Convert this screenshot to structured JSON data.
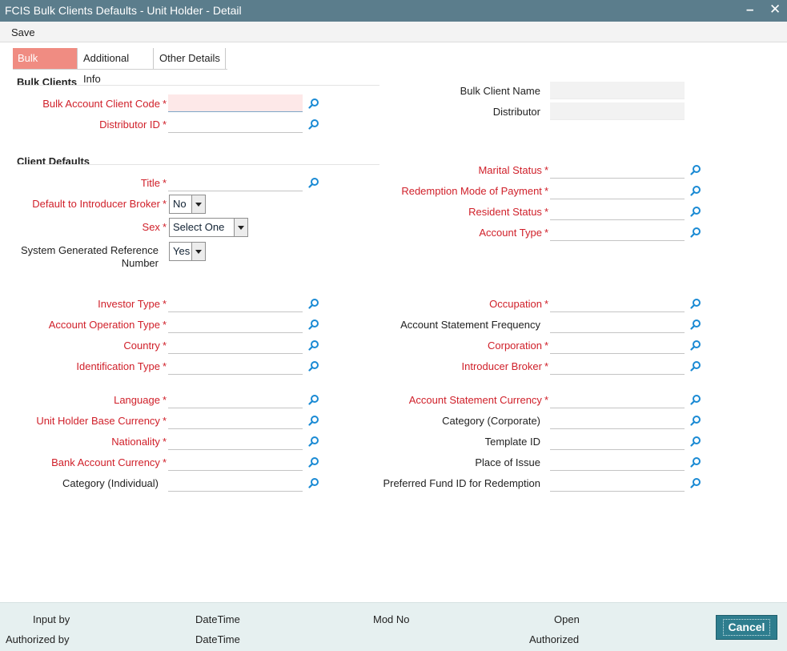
{
  "window": {
    "title": "FCIS Bulk Clients Defaults - Unit Holder - Detail"
  },
  "menu": {
    "save": "Save"
  },
  "tabs": [
    {
      "label": "Bulk Clients",
      "active": true
    },
    {
      "label": "Additional Info",
      "active": false
    },
    {
      "label": "Other Details",
      "active": false
    }
  ],
  "sections": {
    "bulk_clients": "Bulk Clients",
    "client_defaults": "Client Defaults"
  },
  "fields": {
    "bulk_account_client_code": {
      "label": "Bulk Account Client Code",
      "value": ""
    },
    "distributor_id": {
      "label": "Distributor ID",
      "value": ""
    },
    "bulk_client_name": {
      "label": "Bulk Client Name",
      "value": ""
    },
    "distributor": {
      "label": "Distributor",
      "value": ""
    },
    "title": {
      "label": "Title",
      "value": ""
    },
    "default_to_introducer_broker": {
      "label": "Default to Introducer Broker",
      "value": "No"
    },
    "sex": {
      "label": "Sex",
      "value": "Select One"
    },
    "system_generated_reference_number": {
      "label": "System Generated Reference Number",
      "value": "Yes"
    },
    "marital_status": {
      "label": "Marital Status",
      "value": ""
    },
    "redemption_mode_of_payment": {
      "label": "Redemption Mode of Payment",
      "value": ""
    },
    "resident_status": {
      "label": "Resident Status",
      "value": ""
    },
    "account_type": {
      "label": "Account Type",
      "value": ""
    },
    "investor_type": {
      "label": "Investor Type",
      "value": ""
    },
    "account_operation_type": {
      "label": "Account Operation Type",
      "value": ""
    },
    "country": {
      "label": "Country",
      "value": ""
    },
    "identification_type": {
      "label": "Identification Type",
      "value": ""
    },
    "occupation": {
      "label": "Occupation",
      "value": ""
    },
    "account_statement_frequency": {
      "label": "Account Statement Frequency",
      "value": ""
    },
    "corporation": {
      "label": "Corporation",
      "value": ""
    },
    "introducer_broker": {
      "label": "Introducer Broker",
      "value": ""
    },
    "language": {
      "label": "Language",
      "value": ""
    },
    "unit_holder_base_currency": {
      "label": "Unit Holder Base Currency",
      "value": ""
    },
    "nationality": {
      "label": "Nationality",
      "value": ""
    },
    "bank_account_currency": {
      "label": "Bank Account Currency",
      "value": ""
    },
    "category_individual": {
      "label": "Category (Individual)",
      "value": ""
    },
    "account_statement_currency": {
      "label": "Account Statement Currency",
      "value": ""
    },
    "category_corporate": {
      "label": "Category (Corporate)",
      "value": ""
    },
    "template_id": {
      "label": "Template ID",
      "value": ""
    },
    "place_of_issue": {
      "label": "Place of Issue",
      "value": ""
    },
    "preferred_fund_id_for_redemption": {
      "label": "Preferred Fund ID for Redemption",
      "value": ""
    }
  },
  "required_marker": "*",
  "footer": {
    "input_by": "Input by",
    "authorized_by": "Authorized by",
    "datetime_1": "DateTime",
    "datetime_2": "DateTime",
    "mod_no": "Mod No",
    "open": "Open",
    "authorized": "Authorized",
    "cancel": "Cancel"
  },
  "colors": {
    "titlebar": "#5b7d8c",
    "active_tab": "#f08c82",
    "required": "#d0202a",
    "cancel_button": "#2e7d8e",
    "footer": "#e6f0f0",
    "lookup_icon": "#1a8ad4"
  },
  "icons": {
    "lookup": "search-icon",
    "minimize": "minimize-icon",
    "close": "close-icon"
  }
}
